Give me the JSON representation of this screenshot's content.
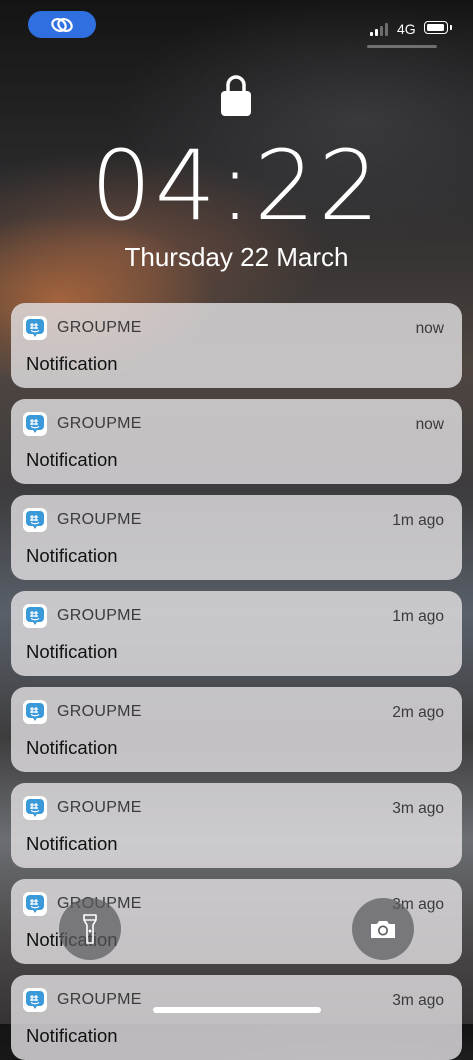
{
  "status_bar": {
    "network_label": "4G",
    "battery_level_fraction": 0.78,
    "signal_bars_active": 2,
    "signal_bars_total": 4,
    "pill_color": "#2f6fe0",
    "pill_icon": "link-icon"
  },
  "lock_screen": {
    "lock_icon": "lock-icon",
    "time": "04:22",
    "date": "Thursday 22 March"
  },
  "notifications": [
    {
      "app": "GROUPME",
      "time": "now",
      "body": "Notification"
    },
    {
      "app": "GROUPME",
      "time": "now",
      "body": "Notification"
    },
    {
      "app": "GROUPME",
      "time": "1m ago",
      "body": "Notification"
    },
    {
      "app": "GROUPME",
      "time": "1m ago",
      "body": "Notification"
    },
    {
      "app": "GROUPME",
      "time": "2m ago",
      "body": "Notification"
    },
    {
      "app": "GROUPME",
      "time": "3m ago",
      "body": "Notification"
    },
    {
      "app": "GROUPME",
      "time": "3m ago",
      "body": "Notification"
    },
    {
      "app": "GROUPME",
      "time": "3m ago",
      "body": "Notification"
    }
  ],
  "app_icon": {
    "name": "groupme-icon",
    "color": "#3a9ad9"
  },
  "quick_actions": {
    "left": "flashlight-icon",
    "right": "camera-icon"
  }
}
